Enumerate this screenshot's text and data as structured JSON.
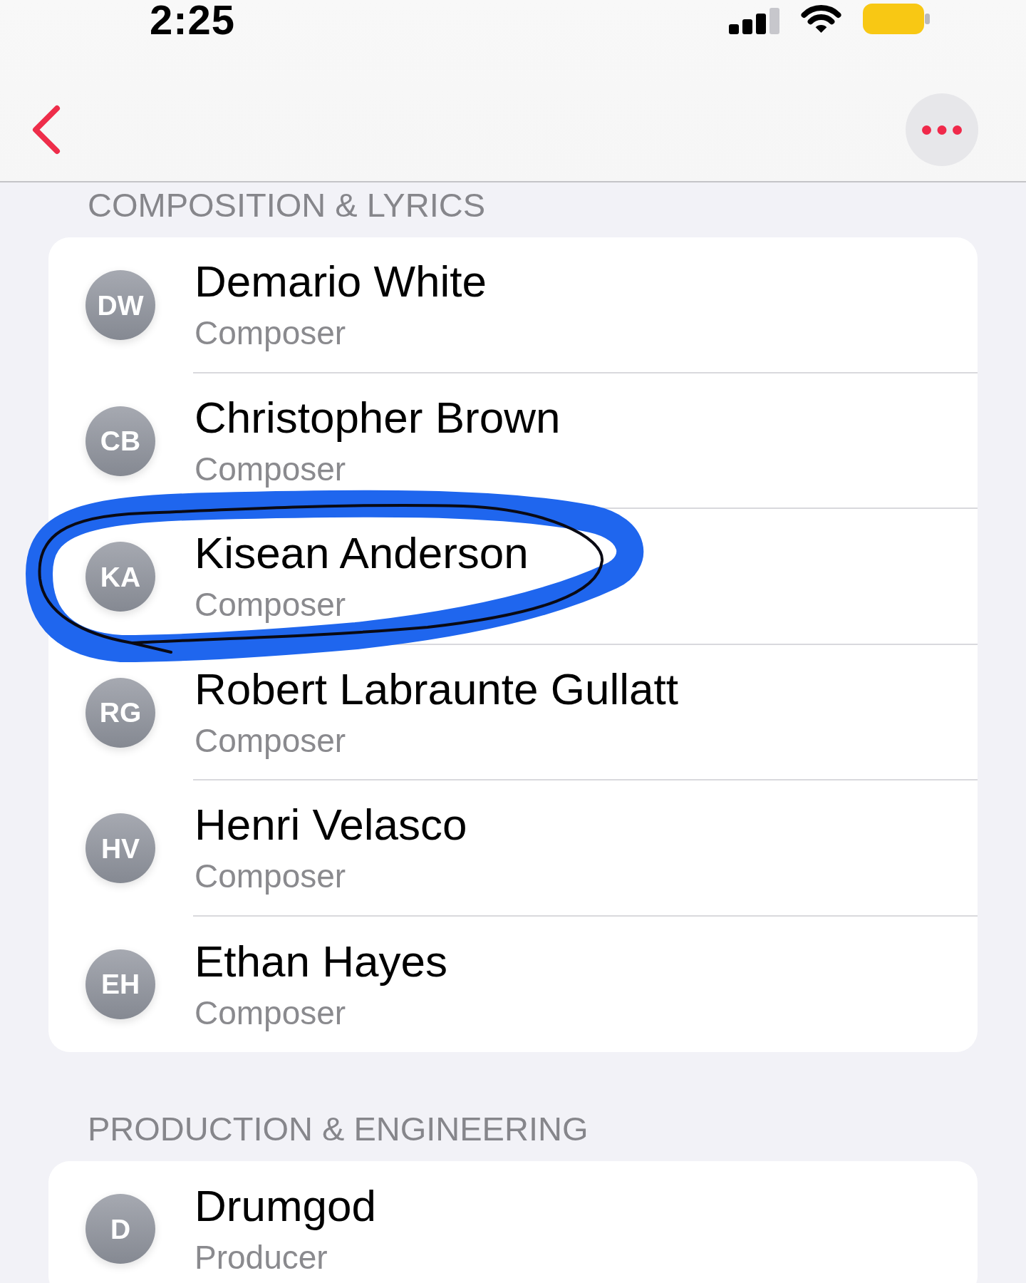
{
  "status_bar": {
    "time": "2:25",
    "low_power_mode": true
  },
  "sections": [
    {
      "title": "COMPOSITION & LYRICS",
      "people": [
        {
          "initials": "DW",
          "name": "Demario White",
          "role": "Composer",
          "circled": false
        },
        {
          "initials": "CB",
          "name": "Christopher Brown",
          "role": "Composer",
          "circled": false
        },
        {
          "initials": "KA",
          "name": "Kisean Anderson",
          "role": "Composer",
          "circled": true
        },
        {
          "initials": "RG",
          "name": "Robert Labraunte Gullatt",
          "role": "Composer",
          "circled": false
        },
        {
          "initials": "HV",
          "name": "Henri Velasco",
          "role": "Composer",
          "circled": false
        },
        {
          "initials": "EH",
          "name": "Ethan Hayes",
          "role": "Composer",
          "circled": false
        }
      ]
    },
    {
      "title": "PRODUCTION & ENGINEERING",
      "people": [
        {
          "initials": "D",
          "name": "Drumgod",
          "role": "Producer",
          "circled": false
        }
      ]
    }
  ]
}
